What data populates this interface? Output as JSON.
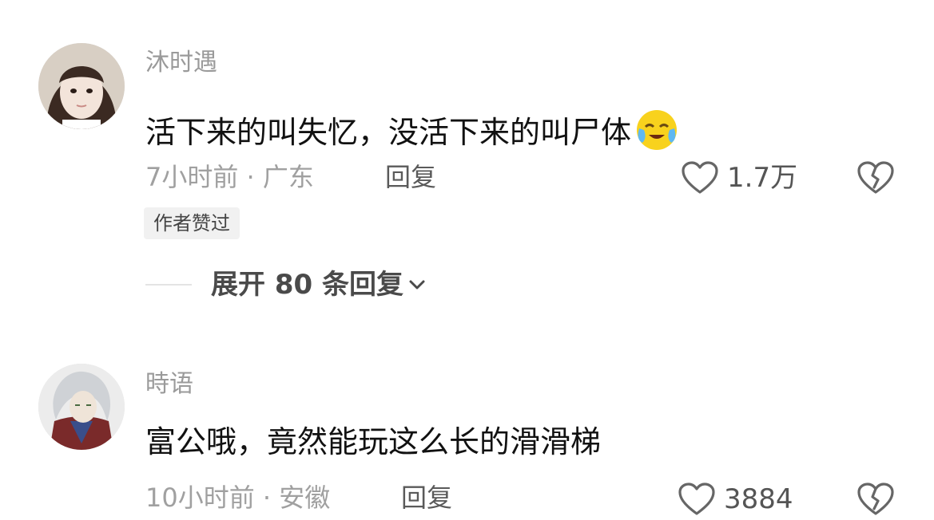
{
  "comments": [
    {
      "username": "沐时遇",
      "text": "活下来的叫失忆，没活下来的叫尸体",
      "emoji": "crying-laughing-emoji",
      "time": "7小时前",
      "location": "广东",
      "meta_separator": " · ",
      "reply_label": "回复",
      "like_count": "1.7万",
      "badge": "作者赞过",
      "expand_label": "展开 80 条回复"
    },
    {
      "username": "時语",
      "text": "富公哦，竟然能玩这么长的滑滑梯",
      "time": "10小时前",
      "location": "安徽",
      "meta_separator": " · ",
      "reply_label": "回复",
      "like_count": "3884"
    }
  ],
  "icons": {
    "like": "heart-outline-icon",
    "dislike": "broken-heart-icon",
    "expand": "chevron-down-icon"
  },
  "colors": {
    "username": "#9a9a9a",
    "text": "#111111",
    "meta": "#a0a0a0",
    "badge_bg": "#f1f1f1"
  }
}
